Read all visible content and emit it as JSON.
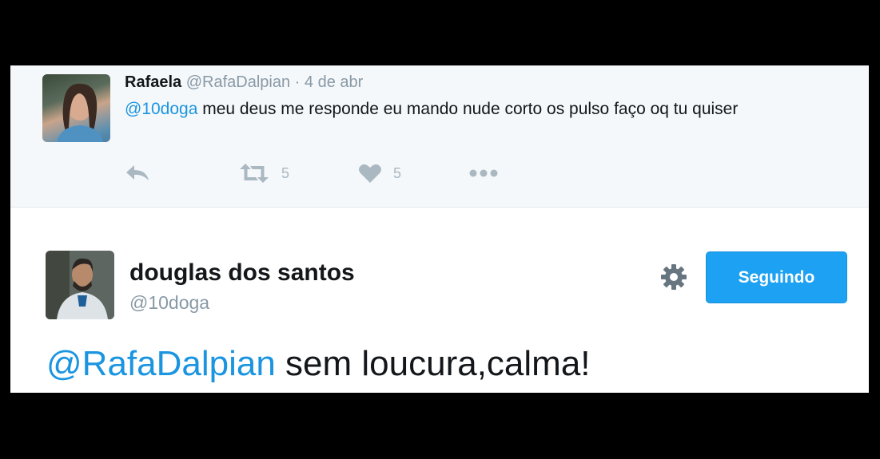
{
  "reply": {
    "name": "Rafaela",
    "handle": "@RafaDalpian",
    "separator": "·",
    "date": "4 de abr",
    "mention": "@10doga",
    "text": " meu deus me responde eu mando nude corto os pulso faço oq tu quiser",
    "retweet_count": "5",
    "like_count": "5"
  },
  "main_tweet": {
    "name": "douglas dos santos",
    "handle": "@10doga",
    "follow_label": "Seguindo",
    "mention": "@RafaDalpian",
    "text": " sem loucura,calma!"
  },
  "colors": {
    "accent": "#1da1f2",
    "mention": "#1b95e0",
    "muted": "#8899a6",
    "icon": "#aab8c2"
  },
  "icons": [
    "reply-icon",
    "retweet-icon",
    "heart-icon",
    "more-icon",
    "gear-icon"
  ]
}
